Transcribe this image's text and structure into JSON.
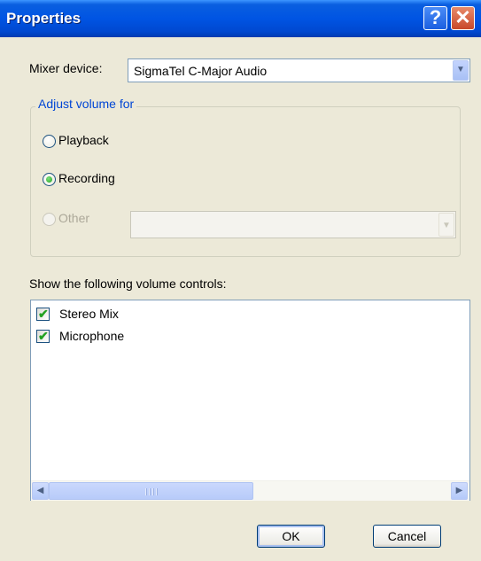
{
  "window": {
    "title": "Properties",
    "help_glyph": "?",
    "close_glyph": "✕"
  },
  "mixer": {
    "label": "Mixer device:",
    "selected": "SigmaTel C-Major Audio"
  },
  "adjust_group": {
    "legend": "Adjust volume for",
    "options": [
      {
        "label": "Playback",
        "checked": false,
        "disabled": false
      },
      {
        "label": "Recording",
        "checked": true,
        "disabled": false
      },
      {
        "label": "Other",
        "checked": false,
        "disabled": true
      }
    ],
    "other_selected": ""
  },
  "controls": {
    "label": "Show the following volume controls:",
    "items": [
      {
        "label": "Stereo Mix",
        "checked": true
      },
      {
        "label": "Microphone",
        "checked": true
      }
    ]
  },
  "buttons": {
    "ok": "OK",
    "cancel": "Cancel"
  },
  "icons": {
    "dropdown": "chevron-down-icon",
    "scroll_left": "arrow-left-icon",
    "scroll_right": "arrow-right-icon",
    "check": "check-icon"
  },
  "colors": {
    "titlebar": "#0054e3",
    "dialog_bg": "#ece9d8",
    "group_legend": "#0046d5",
    "check_green": "#21a121"
  }
}
